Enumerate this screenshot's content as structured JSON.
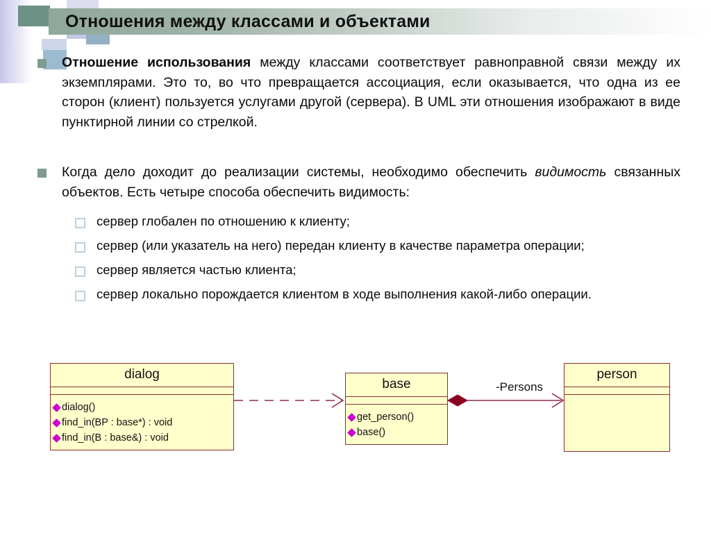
{
  "slide": {
    "title": "Отношения между классами и объектами",
    "title_accent_color": "#8fa79b",
    "bullet_color": "#7f9c91",
    "sub_bullet_color": "#bcd0de"
  },
  "paragraphs": [
    {
      "bold_lead": "Отношение использования",
      "rest": " между классами соответствует равноправной связи между их экземплярами. Это то, во что превращается ассоциация, если оказывается, что одна из ее сторон (клиент) пользуется услугами другой (сервера). В UML эти отношения изображают в виде пунктирной линии со стрелкой."
    },
    {
      "lead": "Когда дело доходит до реализации системы, необходимо обеспечить ",
      "italic": "видимость",
      "tail": " связанных объектов. Есть четыре способа обеспечить видимость:"
    }
  ],
  "sub_items": [
    "сервер глобален по отношению к клиенту;",
    "сервер (или указатель на него) передан клиенту в качестве параметра операции;",
    "сервер является частью клиента;",
    "сервер локально порождается клиентом в ходе выполнения какой-либо операции."
  ],
  "uml": {
    "fill_color": "#ffffcc",
    "border_color": "#8a2f2f",
    "member_marker_color": "#cc00cc",
    "diamond_color": "#8b0020",
    "classes": [
      {
        "name": "dialog",
        "attributes": [],
        "methods": [
          "dialog()",
          "find_in(BP : base*) : void",
          "find_in(B : base&) : void"
        ]
      },
      {
        "name": "base",
        "attributes": [],
        "methods": [
          "get_person()",
          "base()"
        ]
      },
      {
        "name": "person",
        "attributes": [],
        "methods": []
      }
    ],
    "relations": [
      {
        "kind": "dependency",
        "from": "dialog",
        "to": "base",
        "style": "dashed-open-arrow",
        "label": ""
      },
      {
        "kind": "composition",
        "from": "base",
        "to": "person",
        "style": "solid-filled-diamond-open-arrow",
        "label": "-Persons"
      }
    ]
  }
}
